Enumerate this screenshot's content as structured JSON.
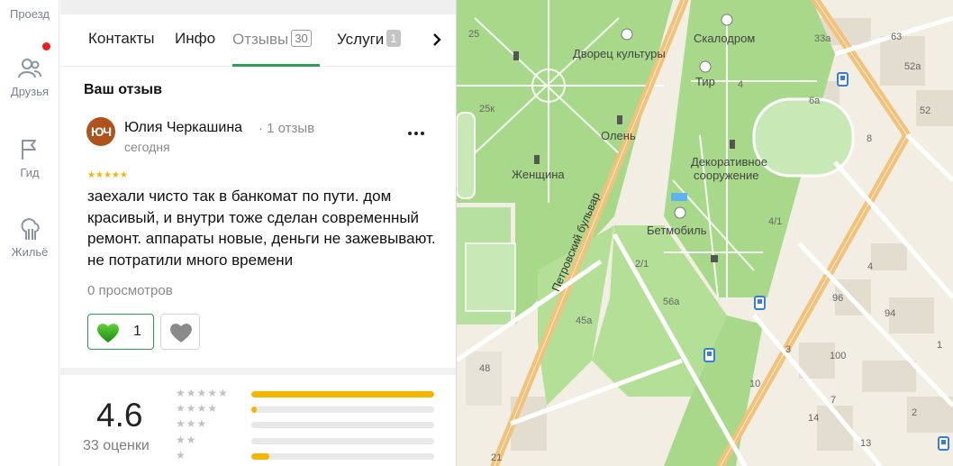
{
  "rail": {
    "top_label": "Проезд",
    "items": [
      {
        "label": "Друзья",
        "icon": "friends-icon"
      },
      {
        "label": "Гид",
        "icon": "flag-icon"
      },
      {
        "label": "Жильё",
        "icon": "housing-icon"
      }
    ]
  },
  "tabs": [
    {
      "label": "Контакты"
    },
    {
      "label": "Инфо"
    },
    {
      "label": "Отзывы",
      "count": "30"
    },
    {
      "label": "Услуги",
      "count": "1"
    }
  ],
  "review_section": {
    "title": "Ваш отзыв",
    "author": {
      "initials": "ЮЧ",
      "name": "Юлия Черкашина",
      "reviews": "· 1 отзыв"
    },
    "date": "сегодня",
    "stars": "★★★★★",
    "text": "заехали чисто так в банкомат по пути. дом красивый, и внутри тоже сделан современный ремонт. аппараты новые, деньги не зажевывают. не потратили много времени",
    "views": "0 просмотров",
    "likes": "1"
  },
  "rating": {
    "value": "4.6",
    "count_label": "33 оценки",
    "distribution": [
      {
        "stars": "★★★★★",
        "fraction": 1.0
      },
      {
        "stars": "★★★★",
        "fraction": 0.03
      },
      {
        "stars": "★★★",
        "fraction": 0.0
      },
      {
        "stars": "★★",
        "fraction": 0.0
      },
      {
        "stars": "★",
        "fraction": 0.1
      }
    ]
  },
  "map": {
    "labels": {
      "dvorets": "Дворец культуры",
      "skalodrom": "Скалодром",
      "tir": "Тир",
      "olen": "Олень",
      "zhenshchina": "Женщина",
      "dekor1": "Декоративное",
      "dekor2": "сооружение",
      "betmobil": "Бетмобиль",
      "street": "Петровский бульвар"
    },
    "numbers": [
      "25",
      "33а",
      "63",
      "52а",
      "52",
      "6а",
      "8",
      "4",
      "25к",
      "4/1",
      "2/1",
      "56а",
      "45а",
      "96",
      "94",
      "100",
      "3",
      "4",
      "48",
      "21",
      "14",
      "13",
      "2",
      "7",
      "10",
      "1"
    ],
    "colors": {
      "park": "#a8d98a",
      "road": "#f2c27a",
      "ground": "#f3eee3",
      "building": "#e3ddd0",
      "accent": "#2a9d56"
    }
  }
}
